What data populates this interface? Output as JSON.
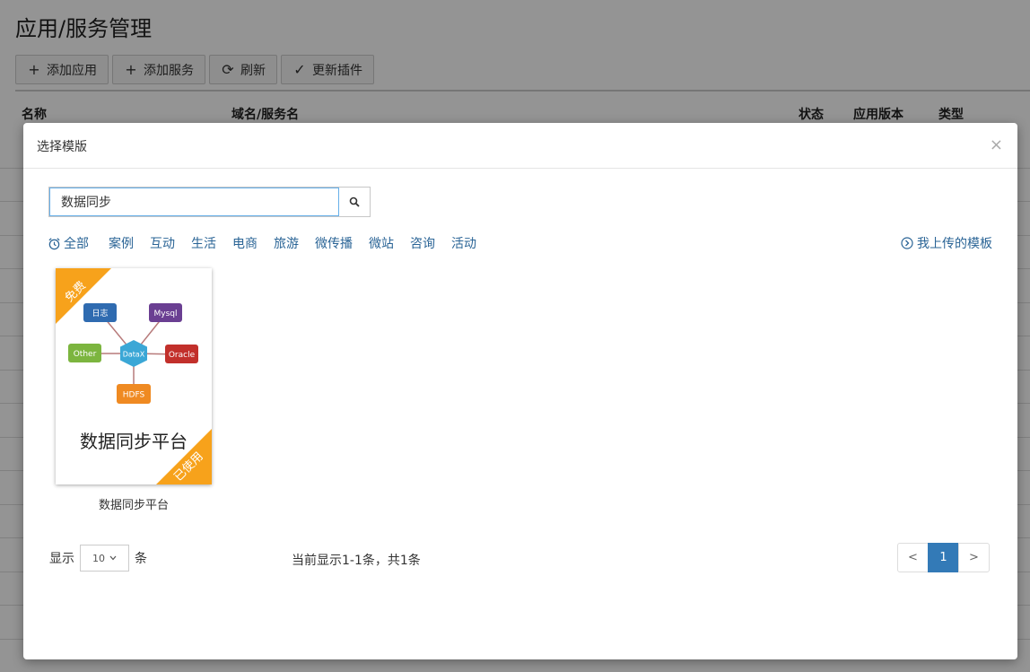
{
  "page": {
    "title": "应用/服务管理",
    "toolbar": [
      {
        "icon": "plus-icon",
        "glyph": "+",
        "label": "添加应用"
      },
      {
        "icon": "plus-icon",
        "glyph": "+",
        "label": "添加服务"
      },
      {
        "icon": "refresh-icon",
        "glyph": "⟳",
        "label": "刷新"
      },
      {
        "icon": "check-icon",
        "glyph": "✓",
        "label": "更新插件"
      }
    ],
    "table_headers": {
      "name": "名称",
      "domain": "域名/服务名",
      "status": "状态",
      "version": "应用版本",
      "type": "类型"
    }
  },
  "modal": {
    "title": "选择模版",
    "close_glyph": "×",
    "search": {
      "value": "数据同步",
      "placeholder": ""
    },
    "categories": [
      "全部",
      "案例",
      "互动",
      "生活",
      "电商",
      "旅游",
      "微传播",
      "微站",
      "咨询",
      "活动"
    ],
    "my_upload": "我上传的模板",
    "template": {
      "name": "数据同步平台",
      "ribbon_top": "免费",
      "ribbon_bottom": "已使用",
      "diagram": {
        "center": "DataX",
        "nodes": [
          "日志",
          "Mysql",
          "Other",
          "Oracle",
          "HDFS"
        ]
      },
      "cover_title": "数据同步平台"
    },
    "pager": {
      "show_label": "显示",
      "page_size": "10",
      "unit_label": "条",
      "info": "当前显示1-1条，共1条",
      "prev": "<",
      "current": "1",
      "next": ">"
    }
  },
  "colors": {
    "link": "#2a6496",
    "primary": "#337ab7",
    "ribbon": "#f7a21b",
    "node_log": "#2f6bb0",
    "node_mysql": "#6a3f92",
    "node_other": "#7cb53f",
    "node_oracle": "#c2302b",
    "node_hdfs": "#ef8a22",
    "node_datax": "#3ba7d6"
  }
}
